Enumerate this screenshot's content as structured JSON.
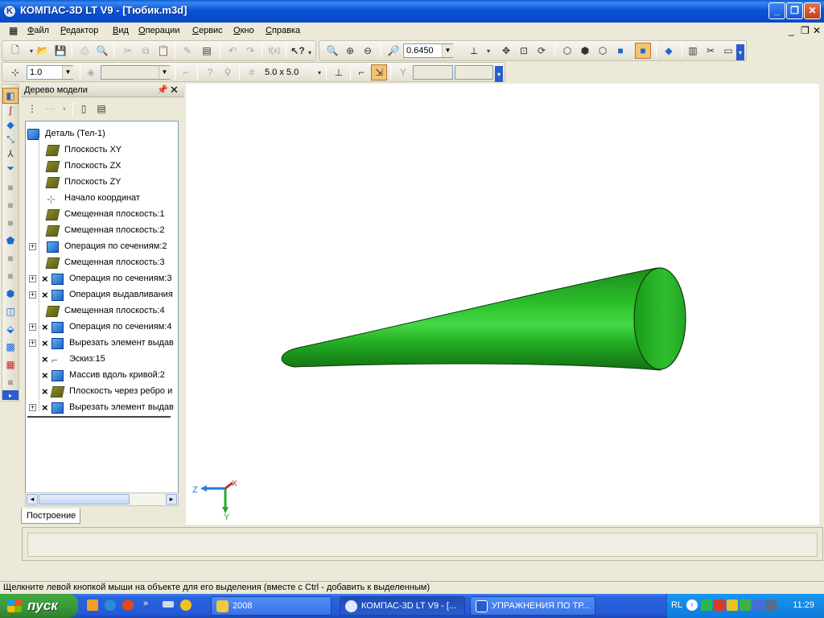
{
  "window": {
    "title": "КОМПАС-3D LT V9 - [Тюбик.m3d]"
  },
  "menu": [
    "Файл",
    "Редактор",
    "Вид",
    "Операции",
    "Сервис",
    "Окно",
    "Справка"
  ],
  "toolbar": {
    "zoom_value": "0.6450",
    "line_width_value": "1.0",
    "grid_value": "5.0 x 5.0"
  },
  "tree": {
    "panel_title": "Дерево модели",
    "tab_label": "Построение",
    "items": [
      {
        "label": "Деталь (Тел-1)",
        "icon": "part-icon",
        "expand": false,
        "excluded": false
      },
      {
        "label": "Плоскость XY",
        "icon": "plane-icon",
        "expand": false,
        "excluded": false
      },
      {
        "label": "Плоскость ZX",
        "icon": "plane-icon",
        "expand": false,
        "excluded": false
      },
      {
        "label": "Плоскость ZY",
        "icon": "plane-icon",
        "expand": false,
        "excluded": false
      },
      {
        "label": "Начало координат",
        "icon": "origin-icon",
        "expand": false,
        "excluded": false
      },
      {
        "label": "Смещенная плоскость:1",
        "icon": "plane-icon",
        "expand": false,
        "excluded": false
      },
      {
        "label": "Смещенная плоскость:2",
        "icon": "plane-icon",
        "expand": false,
        "excluded": false
      },
      {
        "label": "Операция по сечениям:2",
        "icon": "loft-icon",
        "expand": true,
        "excluded": false
      },
      {
        "label": "Смещенная плоскость:3",
        "icon": "plane-icon",
        "expand": false,
        "excluded": false
      },
      {
        "label": "Операция по сечениям:3",
        "icon": "loft-icon",
        "expand": true,
        "excluded": true
      },
      {
        "label": "Операция выдавливания",
        "icon": "extrude-icon",
        "expand": true,
        "excluded": true
      },
      {
        "label": "Смещенная плоскость:4",
        "icon": "plane-icon",
        "expand": false,
        "excluded": false
      },
      {
        "label": "Операция по сечениям:4",
        "icon": "loft-icon",
        "expand": true,
        "excluded": true
      },
      {
        "label": "Вырезать элемент выдав",
        "icon": "cut-extrude-icon",
        "expand": true,
        "excluded": true
      },
      {
        "label": "Эскиз:15",
        "icon": "sketch-icon",
        "expand": false,
        "excluded": true
      },
      {
        "label": "Массив вдоль кривой:2",
        "icon": "curve-array-icon",
        "expand": false,
        "excluded": true
      },
      {
        "label": "Плоскость через ребро и",
        "icon": "plane-icon",
        "expand": false,
        "excluded": true
      },
      {
        "label": "Вырезать элемент выдав",
        "icon": "cut-extrude-icon",
        "expand": true,
        "excluded": true
      }
    ]
  },
  "axes": {
    "z": "Z",
    "x": "X",
    "y": "Y"
  },
  "status": {
    "text": "Щелкните левой кнопкой мыши на объекте для его выделения (вместе с Ctrl - добавить к выделенным)"
  },
  "taskbar": {
    "start_label": "пуск",
    "tasks": [
      "2008",
      "КОМПАС-3D LT V9 - [...",
      "УПРАЖНЕНИЯ ПО ТР..."
    ],
    "lang": "RL",
    "clock": "11:29"
  },
  "colors": {
    "model_green": "#1fa31f",
    "titlebar_blue": "#0a55d6",
    "taskbar_blue": "#245ad8",
    "start_green": "#3c9b3c"
  }
}
